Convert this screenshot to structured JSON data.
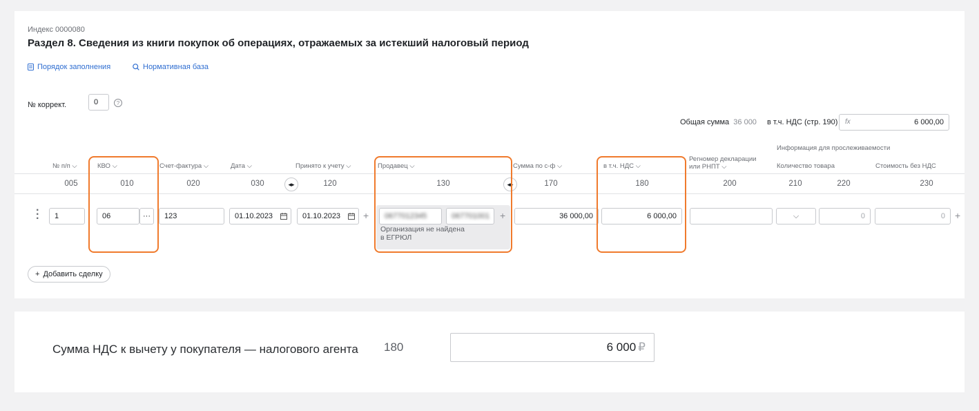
{
  "section": {
    "index": "Индекс 0000080",
    "title": "Раздел 8. Сведения из книги покупок об операциях, отражаемых за истекший налоговый период",
    "links": {
      "procedure": "Порядок заполнения",
      "regulatory": "Нормативная база"
    }
  },
  "correction": {
    "label": "№ коррект.",
    "value": "0"
  },
  "totals": {
    "total_label": "Общая сумма",
    "total_value": "36 000",
    "vat_label": "в т.ч. НДС (стр. 190)",
    "fx": "fx",
    "vat_value": "6 000,00"
  },
  "traceability": {
    "group_label": "Информация для прослеживаемости"
  },
  "columns": {
    "num": "№ п/п",
    "kvo": "КВО",
    "invoice": "Счет-фактура",
    "date": "Дата",
    "accepted": "Принято к учету",
    "seller": "Продавец",
    "amount": "Сумма по с-ф",
    "vat": "в т.ч. НДС",
    "regnum_1": "Регномер декларации",
    "regnum_2": "или РНПТ",
    "qty": "Количество товара",
    "cost": "Стоимость без НДС"
  },
  "codes": {
    "num": "005",
    "kvo": "010",
    "invoice": "020",
    "date": "030",
    "accepted": "120",
    "seller": "130",
    "amount": "170",
    "vat": "180",
    "regnum": "200",
    "qty": "210",
    "c220": "220",
    "cost": "230"
  },
  "row": {
    "num": "1",
    "kvo": "06",
    "invoice": "123",
    "date": "01.10.2023",
    "accepted": "01.10.2023",
    "seller_inn": "0677012345",
    "seller_kpp": "067701001",
    "seller_note": "Организация не найдена в ЕГРЮЛ",
    "amount": "36 000,00",
    "vat": "6 000,00",
    "regnum": "",
    "qty": "0",
    "cost": "0"
  },
  "add_deal": "Добавить сделку",
  "deduction": {
    "label": "Сумма НДС к вычету у покупателя — налогового агента",
    "code": "180",
    "value": "6 000",
    "currency": "₽"
  },
  "colors": {
    "accent": "#2f6ed1",
    "highlight": "#f07a2c"
  },
  "icons": {
    "procedure": "document-icon",
    "regulatory": "search-icon",
    "help": "question-icon",
    "calendar": "calendar-icon",
    "sort": "chevron-down-icon",
    "expand": "expand-columns-icon"
  }
}
